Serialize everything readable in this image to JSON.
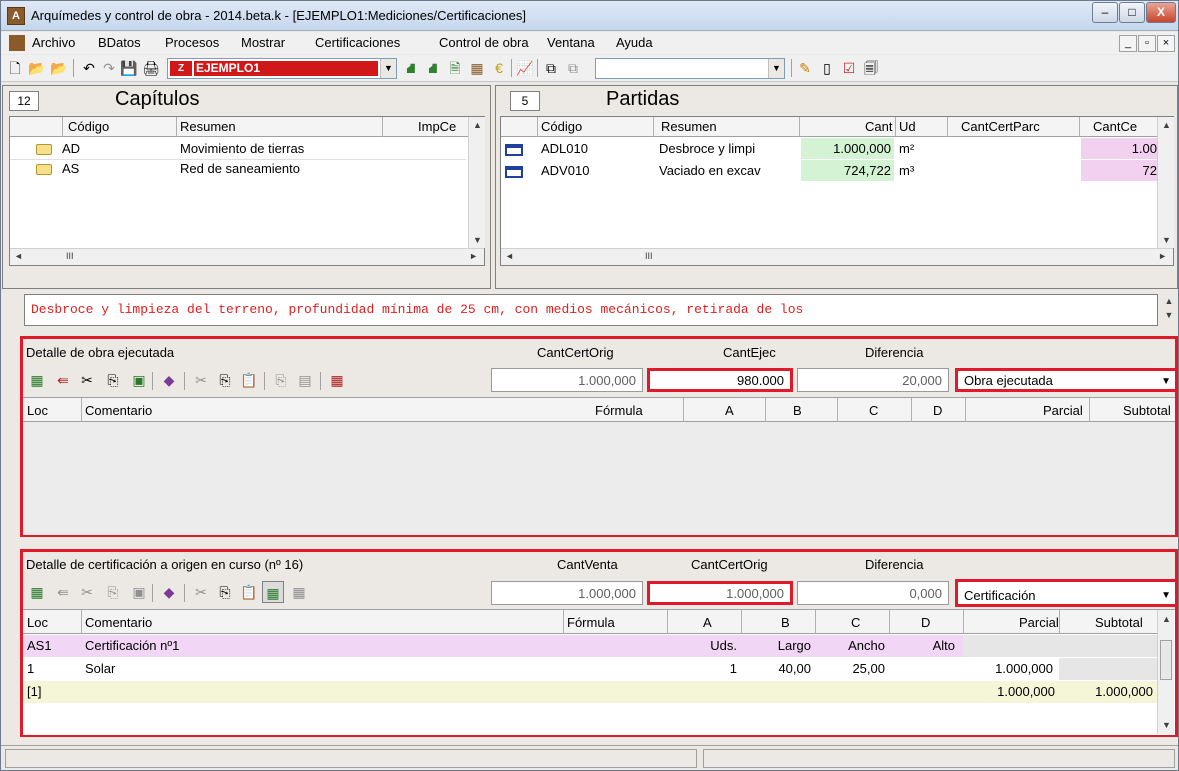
{
  "window": {
    "title": "Arquímedes y control de obra - 2014.beta.k - [EJEMPLO1:Mediciones/Certificaciones]",
    "minimize": "–",
    "restore": "□",
    "close": "X"
  },
  "menu": {
    "items": [
      "Archivo",
      "BDatos",
      "Procesos",
      "Mostrar",
      "Certificaciones",
      "Control de obra",
      "Ventana",
      "Ayuda"
    ],
    "mdi_min": "_",
    "mdi_restore": "▫",
    "mdi_close": "×"
  },
  "toolbar": {
    "project_combo": "EJEMPLO1",
    "empty_combo": ""
  },
  "capitulos": {
    "count": "12",
    "title": "Capítulos",
    "columns": [
      "Código",
      "Resumen",
      "ImpCe"
    ],
    "rows": [
      {
        "code": "AD",
        "summary": "Movimiento de tierras"
      },
      {
        "code": "AS",
        "summary": "Red de saneamiento"
      }
    ],
    "scroll_left": "◄",
    "scroll_right": "►",
    "scroll_grip": "III"
  },
  "partidas": {
    "count": "5",
    "title": "Partidas",
    "columns": [
      "Código",
      "Resumen",
      "Cant",
      "Ud",
      "CantCertParc",
      "CantCe"
    ],
    "rows": [
      {
        "code": "ADL010",
        "summary": "Desbroce y limpi",
        "cant": "1.000,000",
        "ud": "m²",
        "cantce": "1.00"
      },
      {
        "code": "ADV010",
        "summary": "Vaciado en excav",
        "cant": "724,722",
        "ud": "m³",
        "cantce": "72"
      }
    ]
  },
  "description": "Desbroce y limpieza del terreno, profundidad mínima de 25 cm, con medios mecánicos, retirada de los",
  "obra": {
    "title": "Detalle de obra ejecutada",
    "col1_label": "CantCertOrig",
    "col2_label": "CantEjec",
    "col3_label": "Diferencia",
    "col1_value": "1.000,000",
    "col2_value": "980.000",
    "col3_value": "20,000",
    "mode": "Obra ejecutada",
    "columns": [
      "Loc",
      "Comentario",
      "Fórmula",
      "A",
      "B",
      "C",
      "D",
      "Parcial",
      "Subtotal"
    ]
  },
  "cert": {
    "title": "Detalle de certificación a origen en curso (nº 16)",
    "col1_label": "CantVenta",
    "col2_label": "CantCertOrig",
    "col3_label": "Diferencia",
    "col1_value": "1.000,000",
    "col2_value": "1.000,000",
    "col3_value": "0,000",
    "mode": "Certificación",
    "columns": [
      "Loc",
      "Comentario",
      "Fórmula",
      "A",
      "B",
      "C",
      "D",
      "Parcial",
      "Subtotal"
    ],
    "rows": [
      {
        "loc": "AS1",
        "comment": "Certificación nº1",
        "formula": "",
        "a": "Uds.",
        "b": "Largo",
        "c": "Ancho",
        "d": "Alto",
        "parcial": "",
        "subtotal": ""
      },
      {
        "loc": "1",
        "comment": "Solar",
        "formula": "",
        "a": "1",
        "b": "40,00",
        "c": "25,00",
        "d": "",
        "parcial": "1.000,000",
        "subtotal": ""
      },
      {
        "loc": "[1]",
        "comment": "",
        "formula": "",
        "a": "",
        "b": "",
        "c": "",
        "d": "",
        "parcial": "1.000,000",
        "subtotal": "1.000,000"
      }
    ]
  },
  "colors": {
    "highlight_red": "#e01a2a",
    "row_pink": "#f2d6f6",
    "row_yellow": "#f5f5d8",
    "cant_green": "#d4f3d4",
    "cantce_pink": "#f2d0f0"
  }
}
